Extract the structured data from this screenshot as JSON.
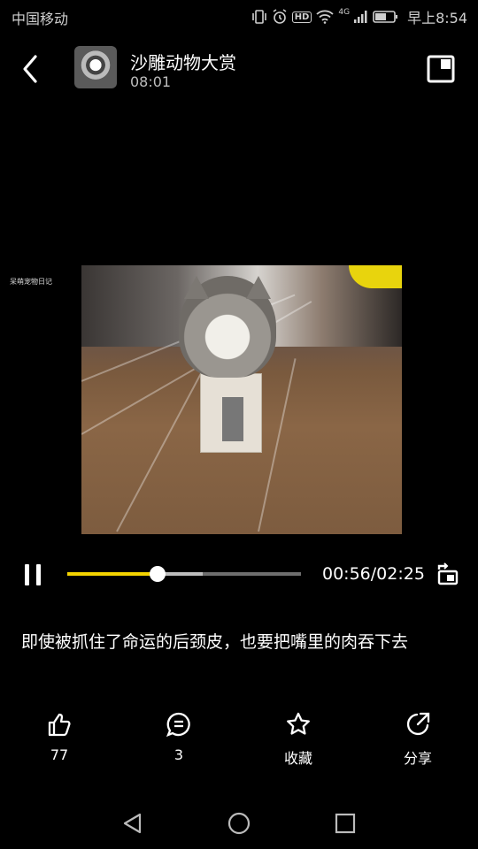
{
  "status_bar": {
    "carrier": "中国移动",
    "network_label": "4G",
    "hd_label": "HD",
    "time": "早上8:54"
  },
  "header": {
    "title": "沙雕动物大赏",
    "subtitle": "08:01"
  },
  "video": {
    "watermark": "呆萌宠物日记"
  },
  "player": {
    "progress": 0.388,
    "buffered": 0.58,
    "time_display": "00:56/02:25",
    "accent_color": "#f5d400"
  },
  "caption": "即使被抓住了命运的后颈皮，也要把嘴里的肉吞下去",
  "actions": [
    {
      "icon": "thumbs-up-icon",
      "label": "77"
    },
    {
      "icon": "comment-icon",
      "label": "3"
    },
    {
      "icon": "star-icon",
      "label": "收藏"
    },
    {
      "icon": "share-icon",
      "label": "分享"
    }
  ]
}
